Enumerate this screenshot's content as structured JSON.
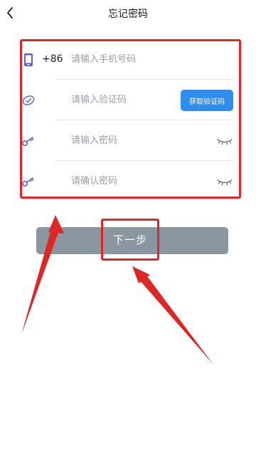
{
  "header": {
    "title": "忘记密码",
    "back_icon": "chevron-left-icon"
  },
  "form": {
    "phone": {
      "icon": "phone-icon",
      "prefix": "+86",
      "placeholder": "请输入手机号码"
    },
    "code": {
      "icon": "shield-check-icon",
      "placeholder": "请输入验证码",
      "button_label": "获取验证码"
    },
    "password": {
      "icon": "key-icon",
      "placeholder": "请输入密码",
      "toggle_icon": "eye-closed-icon"
    },
    "confirm_password": {
      "icon": "key-icon",
      "placeholder": "请确认密码",
      "toggle_icon": "eye-closed-icon"
    }
  },
  "next_button": {
    "label": "下一步"
  },
  "colors": {
    "icon": "#5b5fc7",
    "primary_button": "#2f8df0",
    "next_button": "#8a96a0",
    "annotation": "#e02525"
  }
}
